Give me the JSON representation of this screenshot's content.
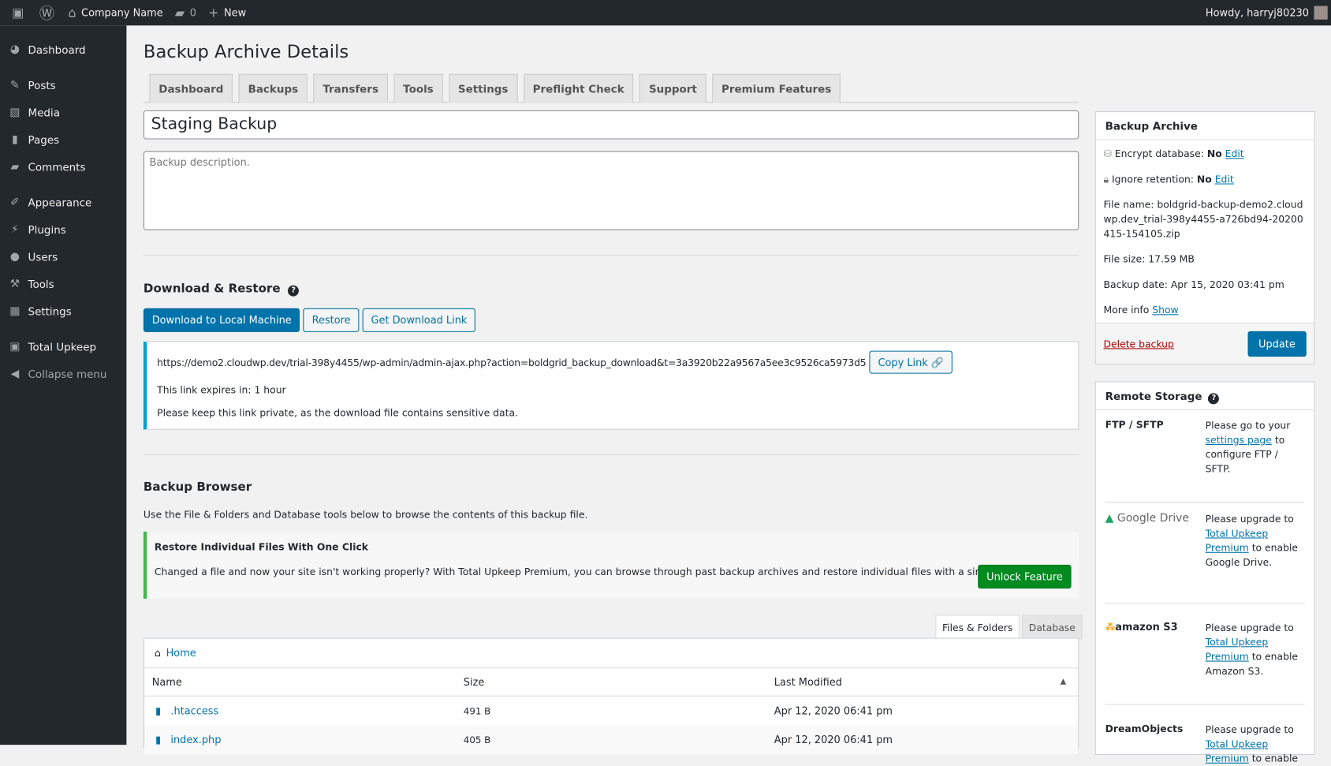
{
  "adminbar": {
    "site": "Company Name",
    "comments": "0",
    "new": "New",
    "greeting": "Howdy, harryj80230"
  },
  "sidebar": {
    "items": [
      {
        "label": "Dashboard",
        "icon": "dashboard-icon"
      },
      {
        "label": "Posts",
        "icon": "pin-icon"
      },
      {
        "label": "Media",
        "icon": "media-icon"
      },
      {
        "label": "Pages",
        "icon": "pages-icon"
      },
      {
        "label": "Comments",
        "icon": "comments-icon"
      },
      {
        "label": "Appearance",
        "icon": "brush-icon"
      },
      {
        "label": "Plugins",
        "icon": "plugin-icon"
      },
      {
        "label": "Users",
        "icon": "user-icon"
      },
      {
        "label": "Tools",
        "icon": "wrench-icon"
      },
      {
        "label": "Settings",
        "icon": "settings-icon"
      },
      {
        "label": "Total Upkeep",
        "icon": "upkeep-icon"
      },
      {
        "label": "Collapse menu",
        "icon": "collapse-icon"
      }
    ]
  },
  "page": {
    "title": "Backup Archive Details",
    "tabs": [
      "Dashboard",
      "Backups",
      "Transfers",
      "Tools",
      "Settings",
      "Preflight Check",
      "Support",
      "Premium Features"
    ],
    "backup_title": "Staging Backup",
    "description_placeholder": "Backup description."
  },
  "download": {
    "heading": "Download & Restore",
    "buttons": [
      "Download to Local Machine",
      "Restore",
      "Get Download Link"
    ],
    "url": "https://demo2.cloudwp.dev/trial-398y4455/wp-admin/admin-ajax.php?action=boldgrid_backup_download&t=3a3920b22a9567a5ee3c9526ca5973d5",
    "copy": "Copy Link",
    "expires_label": "This link expires in:",
    "expires": "1 hour",
    "private": "Please keep this link private, as the download file contains sensitive data."
  },
  "browser": {
    "heading": "Backup Browser",
    "desc": "Use the File & Folders and Database tools below to browse the contents of this backup file.",
    "promo_title": "Restore Individual Files With One Click",
    "promo_text": "Changed a file and now your site isn't working properly? With Total Upkeep Premium, you can browse through past backup archives and restore individual files with a single click.",
    "unlock": "Unlock Feature",
    "tabs": [
      "Files & Folders",
      "Database"
    ],
    "home": "Home",
    "columns": [
      "Name",
      "Size",
      "Last Modified"
    ],
    "rows": [
      {
        "name": ".htaccess",
        "size": "491 B",
        "modified": "Apr 12, 2020 06:41 pm"
      },
      {
        "name": "index.php",
        "size": "405 B",
        "modified": "Apr 12, 2020 06:41 pm"
      }
    ]
  },
  "archive": {
    "heading": "Backup Archive",
    "encrypt_label": "Encrypt database:",
    "encrypt": "No",
    "retention_label": "Ignore retention:",
    "retention": "No",
    "edit": "Edit",
    "filename_label": "File name:",
    "filename": "boldgrid-backup-demo2.cloudwp.dev_trial-398y4455-a726bd94-20200415-154105.zip",
    "size_label": "File size:",
    "size": "17.59 MB",
    "date_label": "Backup date:",
    "date": "Apr 15, 2020 03:41 pm",
    "more_label": "More info",
    "show": "Show",
    "delete": "Delete backup",
    "update": "Update"
  },
  "remote": {
    "heading": "Remote Storage",
    "ftp": "FTP / SFTP",
    "ftp_pre": "Please go to your",
    "ftp_link": "settings page",
    "ftp_post": "to configure FTP / SFTP.",
    "upgrade_pre": "Please upgrade to",
    "upgrade_link1": "Total Upkeep",
    "upgrade_link2": "Premium",
    "upgrade_post": "to enable",
    "gd": "Google Drive",
    "gd_target": "Google Drive.",
    "s3_logo": "amazon S3",
    "s3_target": "Amazon S3.",
    "dream": "DreamObjects"
  }
}
